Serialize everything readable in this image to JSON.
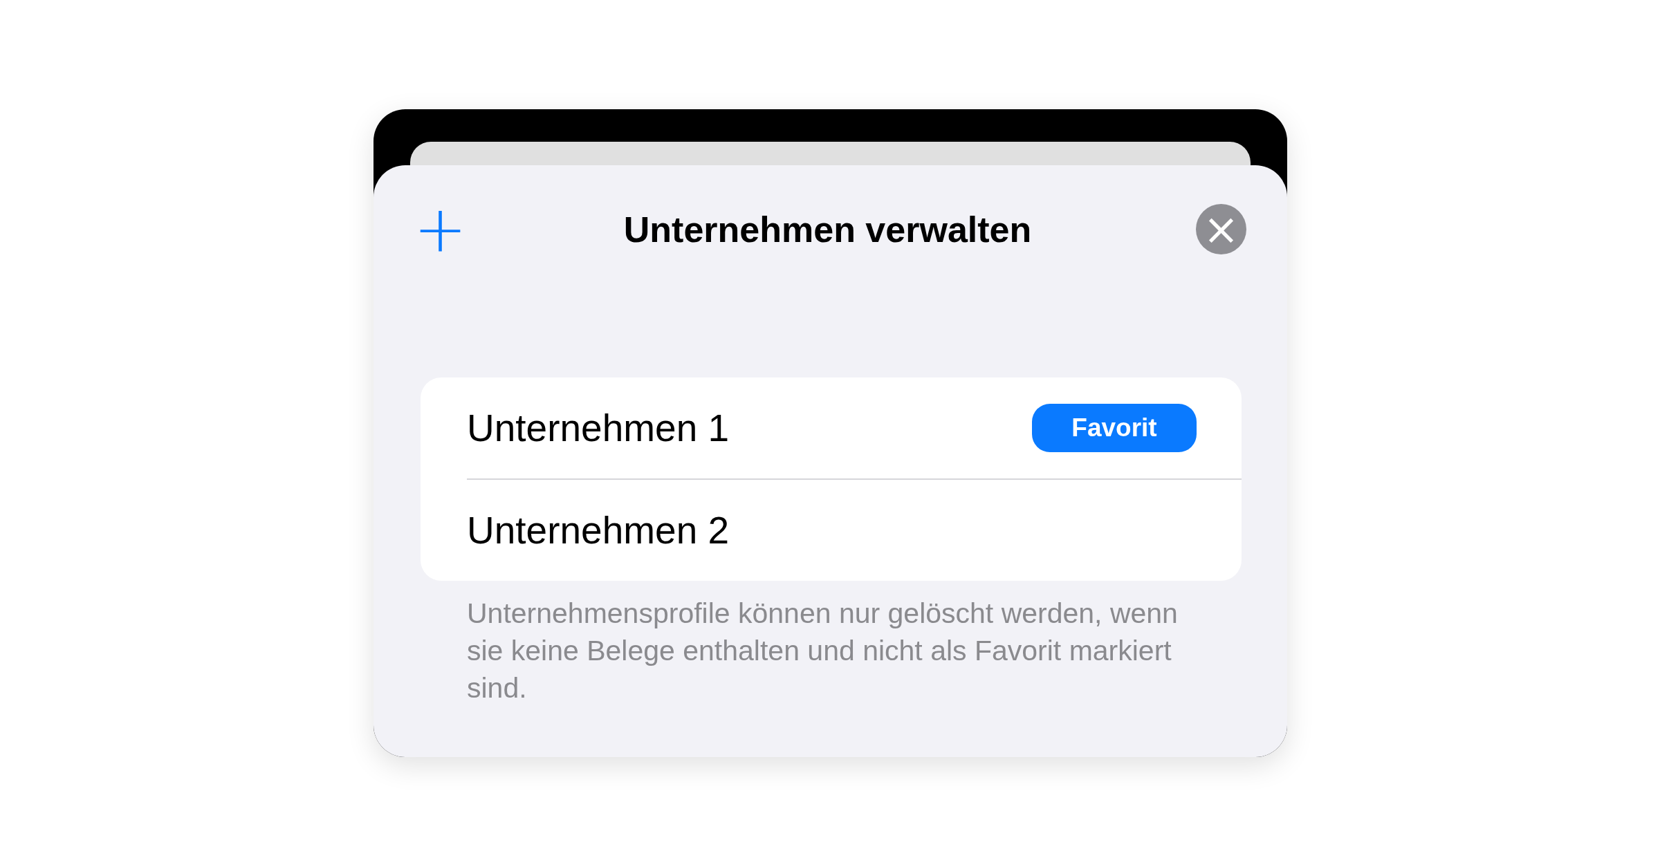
{
  "sheet": {
    "title": "Unternehmen verwalten",
    "add_button": {
      "label": "+"
    },
    "close_button": {
      "label": "×"
    }
  },
  "companies": [
    {
      "name": "Unternehmen 1",
      "badge": "Favorit"
    },
    {
      "name": "Unternehmen 2"
    }
  ],
  "footer_note": "Unternehmensprofile können nur gelöscht werden, wenn sie keine Belege enthalten und nicht als Favorit markiert sind."
}
